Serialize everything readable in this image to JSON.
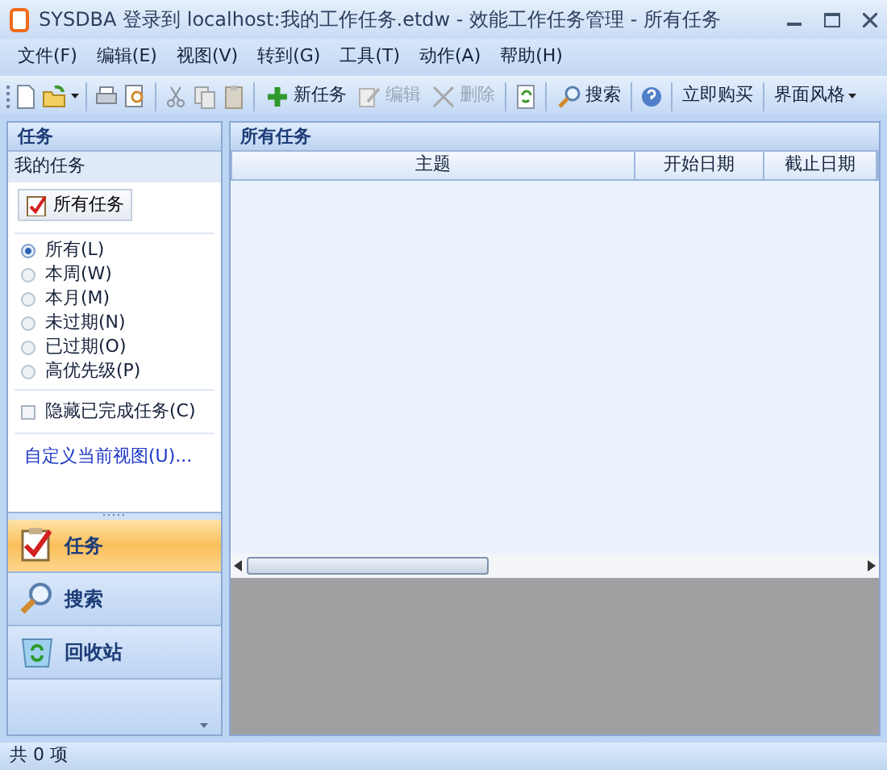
{
  "window": {
    "title": "SYSDBA 登录到 localhost:我的工作任务.etdw - 效能工作任务管理 - 所有任务"
  },
  "menu": [
    "文件(F)",
    "编辑(E)",
    "视图(V)",
    "转到(G)",
    "工具(T)",
    "动作(A)",
    "帮助(H)"
  ],
  "toolbar": [
    {
      "label": "新任务",
      "disabled": false
    },
    {
      "label": "编辑",
      "disabled": true
    },
    {
      "label": "删除",
      "disabled": true
    },
    {
      "label": "搜索",
      "disabled": false
    },
    {
      "label": "立即购买",
      "disabled": false
    },
    {
      "label": "界面风格",
      "disabled": false
    }
  ],
  "sidebar": {
    "title": "任务",
    "section": "我的任务",
    "view_button": "所有任务",
    "filters": [
      {
        "label": "所有(L)",
        "selected": true
      },
      {
        "label": "本周(W)",
        "selected": false
      },
      {
        "label": "本月(M)",
        "selected": false
      },
      {
        "label": "未过期(N)",
        "selected": false
      },
      {
        "label": "已过期(O)",
        "selected": false
      },
      {
        "label": "高优先级(P)",
        "selected": false
      }
    ],
    "hide_completed": {
      "label": "隐藏已完成任务(C)",
      "checked": false
    },
    "customize_link": "自定义当前视图(U)...",
    "nav": [
      {
        "label": "任务",
        "selected": true
      },
      {
        "label": "搜索",
        "selected": false
      },
      {
        "label": "回收站",
        "selected": false
      }
    ]
  },
  "main": {
    "title": "所有任务",
    "columns": [
      "主题",
      "开始日期",
      "截止日期"
    ]
  },
  "status_bar": "共 0 项"
}
